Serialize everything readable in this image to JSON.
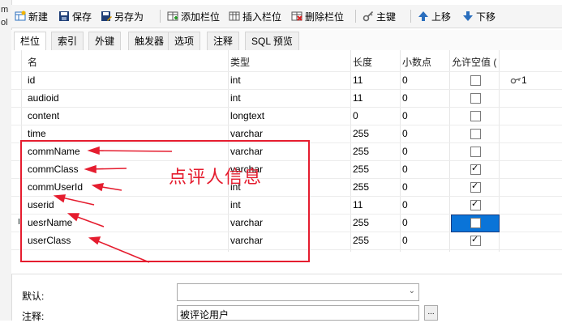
{
  "window": {
    "left_strip": [
      "m",
      "ol"
    ]
  },
  "toolbar": {
    "buttons": [
      {
        "label": "新建",
        "icon": "new-table-icon"
      },
      {
        "label": "保存",
        "icon": "save-icon"
      },
      {
        "label": "另存为",
        "icon": "save-as-icon"
      },
      {
        "label": "添加栏位",
        "icon": "add-column-icon"
      },
      {
        "label": "插入栏位",
        "icon": "insert-column-icon"
      },
      {
        "label": "删除栏位",
        "icon": "delete-column-icon"
      },
      {
        "label": "主键",
        "icon": "key-icon"
      },
      {
        "label": "上移",
        "icon": "arrow-up-icon"
      },
      {
        "label": "下移",
        "icon": "arrow-down-icon"
      }
    ]
  },
  "tabs": [
    "栏位",
    "索引",
    "外键",
    "触发器",
    "选项",
    "注释",
    "SQL 预览"
  ],
  "active_tab": "栏位",
  "table": {
    "headers": [
      "名",
      "类型",
      "长度",
      "小数点",
      "允许空值 (",
      ""
    ],
    "rows": [
      {
        "name": "id",
        "type": "int",
        "length": "11",
        "decimals": "0",
        "nullable": false,
        "key": "1",
        "has_key": true
      },
      {
        "name": "audioid",
        "type": "int",
        "length": "11",
        "decimals": "0",
        "nullable": false,
        "key": "",
        "has_key": false
      },
      {
        "name": "content",
        "type": "longtext",
        "length": "0",
        "decimals": "0",
        "nullable": false,
        "key": "",
        "has_key": false
      },
      {
        "name": "time",
        "type": "varchar",
        "length": "255",
        "decimals": "0",
        "nullable": false,
        "key": "",
        "has_key": false
      },
      {
        "name": "commName",
        "type": "varchar",
        "length": "255",
        "decimals": "0",
        "nullable": false,
        "key": "",
        "has_key": false
      },
      {
        "name": "commClass",
        "type": "varchar",
        "length": "255",
        "decimals": "0",
        "nullable": true,
        "key": "",
        "has_key": false
      },
      {
        "name": "commUserId",
        "type": "int",
        "length": "255",
        "decimals": "0",
        "nullable": true,
        "key": "",
        "has_key": false
      },
      {
        "name": "userid",
        "type": "int",
        "length": "11",
        "decimals": "0",
        "nullable": true,
        "key": "",
        "has_key": false
      },
      {
        "name": "uesrName",
        "type": "varchar",
        "length": "255",
        "decimals": "0",
        "nullable": false,
        "key": "",
        "has_key": false,
        "selected": true
      },
      {
        "name": "userClass",
        "type": "varchar",
        "length": "255",
        "decimals": "0",
        "nullable": true,
        "key": "",
        "has_key": false
      }
    ]
  },
  "annotation": {
    "text": "点评人信息",
    "color": "#e51d2f"
  },
  "properties": {
    "default_label": "默认:",
    "default_value": "",
    "comment_label": "注释:",
    "comment_value": "被评论用户",
    "more_button": "..."
  },
  "colors": {
    "selection": "#0a74d8",
    "annotation_red": "#e51d2f"
  }
}
